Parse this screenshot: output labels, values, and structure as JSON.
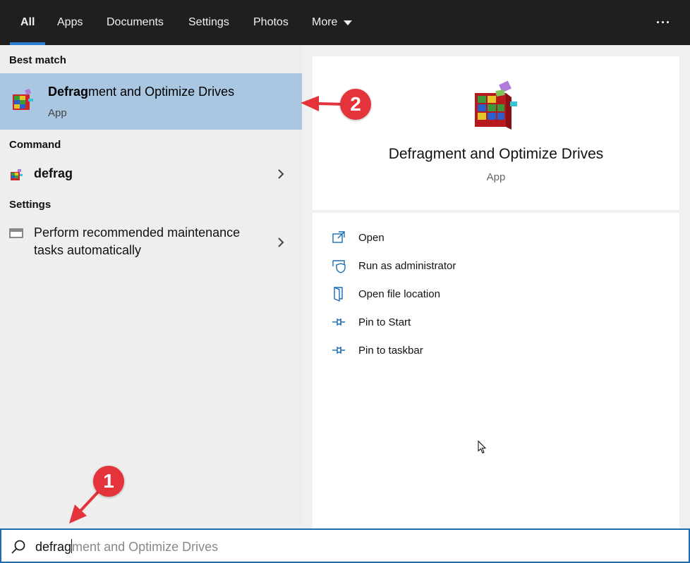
{
  "tabs": [
    {
      "label": "All",
      "active": true
    },
    {
      "label": "Apps"
    },
    {
      "label": "Documents"
    },
    {
      "label": "Settings"
    },
    {
      "label": "Photos"
    },
    {
      "label": "More"
    }
  ],
  "left": {
    "best_match_label": "Best match",
    "best_match": {
      "title_bold": "Defrag",
      "title_rest": "ment and Optimize Drives",
      "subtitle": "App"
    },
    "command_label": "Command",
    "command_item": "defrag",
    "settings_label": "Settings",
    "settings_item_line1": "Perform recommended maintenance",
    "settings_item_line2": "tasks automatically"
  },
  "detail": {
    "title": "Defragment and Optimize Drives",
    "subtitle": "App",
    "actions": [
      {
        "label": "Open",
        "icon": "open-icon"
      },
      {
        "label": "Run as administrator",
        "icon": "shield-icon"
      },
      {
        "label": "Open file location",
        "icon": "file-location-icon"
      },
      {
        "label": "Pin to Start",
        "icon": "pin-icon"
      },
      {
        "label": "Pin to taskbar",
        "icon": "pin-icon"
      }
    ]
  },
  "search": {
    "typed": "defrag",
    "suggestion": "ment and Optimize Drives"
  },
  "annotations": {
    "step1": "1",
    "step2": "2"
  },
  "colors": {
    "tabbar": "#1f1f1f",
    "accent": "#2b7fd2",
    "selection": "#a9c7e1",
    "annotation": "#e5333b"
  }
}
